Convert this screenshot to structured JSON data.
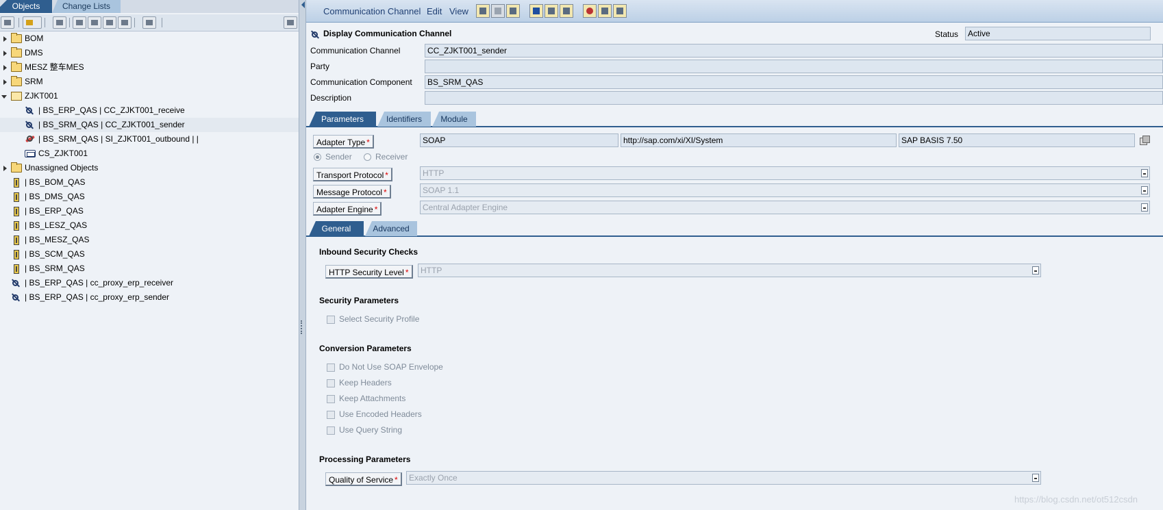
{
  "left": {
    "tabs": {
      "objects": "Objects",
      "change_lists": "Change Lists"
    },
    "tree": [
      {
        "label": "BOM",
        "icon": "folder-icon",
        "arrow": "right",
        "indent": 0
      },
      {
        "label": "DMS",
        "icon": "folder-icon",
        "arrow": "right",
        "indent": 0
      },
      {
        "label": "MESZ   整车MES",
        "icon": "folder-icon",
        "arrow": "right",
        "indent": 0
      },
      {
        "label": "SRM",
        "icon": "folder-icon",
        "arrow": "right",
        "indent": 0
      },
      {
        "label": "ZJKT001",
        "icon": "folder-open-icon",
        "arrow": "down",
        "indent": 0
      },
      {
        "label": "| BS_ERP_QAS | CC_ZJKT001_receive",
        "icon": "channel-icon",
        "indent": 1
      },
      {
        "label": "| BS_SRM_QAS | CC_ZJKT001_sender",
        "icon": "channel-icon",
        "indent": 1
      },
      {
        "label": "| BS_SRM_QAS | SI_ZJKT001_outbound |  |",
        "icon": "agreement-icon",
        "indent": 1
      },
      {
        "label": "CS_ZJKT001",
        "icon": "scenario-icon",
        "indent": 1
      },
      {
        "label": "Unassigned Objects",
        "icon": "folder-icon",
        "arrow": "right",
        "indent": 0
      },
      {
        "label": "| BS_BOM_QAS",
        "icon": "system-icon",
        "indent": 0
      },
      {
        "label": "| BS_DMS_QAS",
        "icon": "system-icon",
        "indent": 0
      },
      {
        "label": "| BS_ERP_QAS",
        "icon": "system-icon",
        "indent": 0
      },
      {
        "label": "| BS_LESZ_QAS",
        "icon": "system-icon",
        "indent": 0
      },
      {
        "label": "| BS_MESZ_QAS",
        "icon": "system-icon",
        "indent": 0
      },
      {
        "label": "| BS_SCM_QAS",
        "icon": "system-icon",
        "indent": 0
      },
      {
        "label": "| BS_SRM_QAS",
        "icon": "system-icon",
        "indent": 0
      },
      {
        "label": "| BS_ERP_QAS | cc_proxy_erp_receiver",
        "icon": "channel-icon",
        "indent": 0
      },
      {
        "label": "| BS_ERP_QAS | cc_proxy_erp_sender",
        "icon": "channel-icon",
        "indent": 0
      }
    ]
  },
  "menu": {
    "communication_channel": "Communication Channel",
    "edit": "Edit",
    "view": "View"
  },
  "header": {
    "title": "Display Communication Channel",
    "status_label": "Status",
    "status_value": "Active",
    "channel_label": "Communication Channel",
    "channel_value": "CC_ZJKT001_sender",
    "party_label": "Party",
    "party_value": "",
    "component_label": "Communication Component",
    "component_value": "BS_SRM_QAS",
    "description_label": "Description",
    "description_value": ""
  },
  "main_tabs": {
    "parameters": "Parameters",
    "identifiers": "Identifiers",
    "module": "Module"
  },
  "parameters": {
    "adapter_type_label": "Adapter Type",
    "adapter_type": "SOAP",
    "adapter_namespace": "http://sap.com/xi/XI/System",
    "adapter_swc": "SAP BASIS 7.50",
    "sender_label": "Sender",
    "receiver_label": "Receiver",
    "transport_protocol_label": "Transport Protocol",
    "transport_protocol": "HTTP",
    "message_protocol_label": "Message Protocol",
    "message_protocol": "SOAP 1.1",
    "adapter_engine_label": "Adapter Engine",
    "adapter_engine": "Central Adapter Engine"
  },
  "sub_tabs": {
    "general": "General",
    "advanced": "Advanced"
  },
  "general": {
    "inbound_security_title": "Inbound Security Checks",
    "http_security_label": "HTTP Security Level",
    "http_security": "HTTP",
    "security_params_title": "Security Parameters",
    "select_security_profile": "Select Security Profile",
    "conversion_title": "Conversion Parameters",
    "no_soap_envelope": "Do Not Use SOAP Envelope",
    "keep_headers": "Keep Headers",
    "keep_attachments": "Keep Attachments",
    "use_encoded_headers": "Use Encoded Headers",
    "use_query_string": "Use Query String",
    "processing_title": "Processing Parameters",
    "qos_label": "Quality of Service",
    "qos": "Exactly Once"
  },
  "watermark": "https://blog.csdn.net/ot512csdn",
  "colors": {
    "tab_active": "#2f5e8f",
    "tab_inactive": "#a9c4de",
    "background": "#eef2f7",
    "required": "#dd0000"
  }
}
